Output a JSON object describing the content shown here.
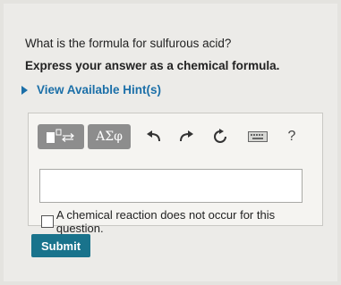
{
  "question": "What is the formula for sulfurous acid?",
  "instruction": "Express your answer as a chemical formula.",
  "hint_link": "View Available Hint(s)",
  "toolbar": {
    "greek_label": "ΑΣφ",
    "help_label": "?",
    "icons": [
      "template-icon",
      "undo-icon",
      "redo-icon",
      "reset-icon",
      "keyboard-icon",
      "help-icon"
    ]
  },
  "answer": {
    "value": ""
  },
  "no_reaction": {
    "label": "A chemical reaction does not occur for this question.",
    "checked": false
  },
  "submit_label": "Submit",
  "colors": {
    "link": "#1b6fa8",
    "submit": "#19738c",
    "toolbar_button": "#8d8d8d"
  }
}
